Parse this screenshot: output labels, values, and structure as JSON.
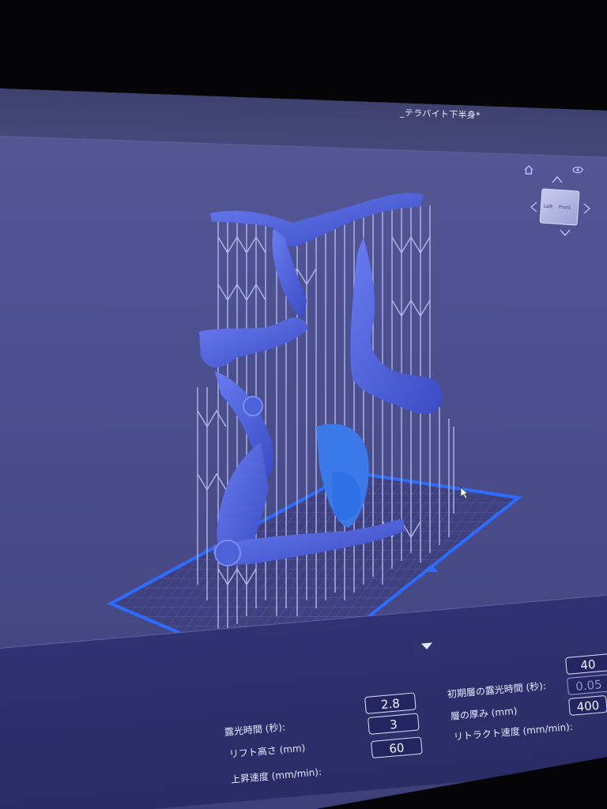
{
  "window": {
    "title": "_テラバイト下半身*"
  },
  "gizmo": {
    "icons": [
      "home-icon",
      "eye-icon",
      "arrow-up-icon",
      "arrow-left-icon",
      "arrow-right-icon",
      "arrow-down-icon"
    ],
    "cube_left": "Left",
    "cube_front": "Front"
  },
  "colors": {
    "screen_bg": "#4e5190",
    "model": "#4f61d8",
    "supports": "#a9b6ec",
    "plate_outline": "#2d6cff",
    "panel_bg": "#2f3170"
  },
  "params": {
    "exposure_time_label": "露光時間 (秒):",
    "exposure_time_value": "2.8",
    "lift_height_label": "リフト高さ (mm)",
    "lift_height_value": "3",
    "lift_speed_label": "上昇速度 (mm/min):",
    "lift_speed_value": "60",
    "bottom_exposure_label": "初期層の露光時間 (秒):",
    "bottom_exposure_value": "40",
    "layer_height_label": "層の厚み (mm)",
    "layer_height_value": "0.05",
    "retract_speed_label": "リトラクト速度 (mm/min):",
    "retract_speed_value": "400"
  }
}
